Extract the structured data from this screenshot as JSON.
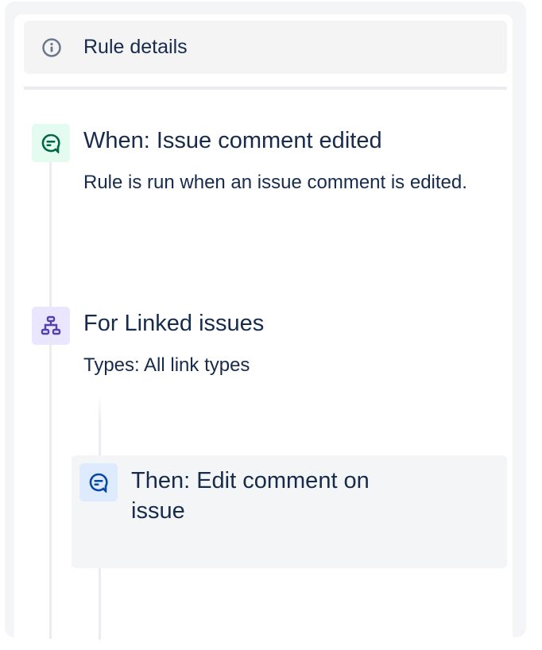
{
  "rule_details": {
    "label": "Rule details",
    "icon": "info-icon"
  },
  "components": [
    {
      "title": "When: Issue comment edited",
      "description": "Rule is run when an issue comment is edited.",
      "icon": "comment-icon",
      "color": "#006644",
      "bg": "#e3fcef"
    },
    {
      "title": "For Linked issues",
      "description": "Types: All link types",
      "icon": "hierarchy-icon",
      "color": "#5243aa",
      "bg": "#eae6ff"
    },
    {
      "title": "Then: Edit comment on issue",
      "icon": "comment-icon",
      "color": "#0747a6",
      "bg": "#deebff"
    }
  ]
}
